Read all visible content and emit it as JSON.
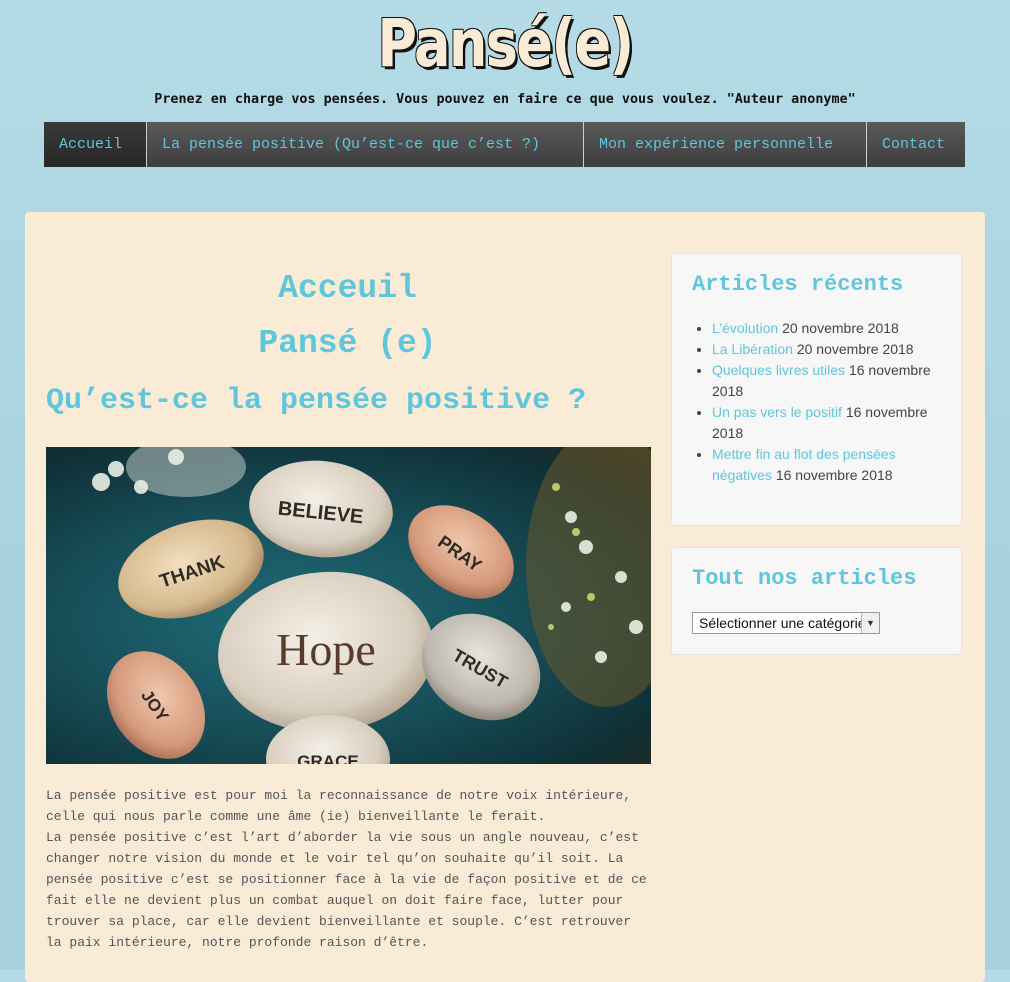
{
  "header": {
    "site_title": "Pansé(e)",
    "tagline": "Prenez en charge vos pensées. Vous pouvez en faire ce que vous voulez. \"Auteur anonyme\""
  },
  "nav": {
    "items": [
      {
        "label": "Accueil"
      },
      {
        "label": "La pensée positive (Qu’est-ce que c’est ?)"
      },
      {
        "label": "Mon expérience personnelle"
      },
      {
        "label": "Contact"
      }
    ]
  },
  "main": {
    "title1": "Acceuil",
    "title2": "Pansé (e)",
    "question": "Qu’est-ce la pensée positive ?",
    "image": {
      "stones": [
        "BELIEVE",
        "THANK",
        "PRAY",
        "Hope",
        "TRUST",
        "JOY",
        "GRACE"
      ]
    },
    "paragraph1": "La pensée positive est pour moi la reconnaissance de notre voix intérieure, celle qui nous parle comme une âme (ie) bienveillante le ferait.",
    "paragraph2": "La pensée positive c’est l’art d’aborder la vie sous un angle nouveau, c’est changer notre vision du monde et le voir tel qu’on souhaite qu’il soit. La pensée positive c’est se positionner face à la vie de façon positive et de ce fait elle ne devient plus un combat auquel on doit faire face, lutter pour trouver sa place, car elle devient bienveillante et souple. C’est retrouver la paix intérieure, notre profonde raison d’être."
  },
  "sidebar": {
    "recent": {
      "title": "Articles récents",
      "items": [
        {
          "link": "L’évolution",
          "date": "20 novembre 2018"
        },
        {
          "link": "La Libération",
          "date": "20 novembre 2018"
        },
        {
          "link": "Quelques livres utiles",
          "date": "16 novembre 2018"
        },
        {
          "link": "Un pas vers le positif",
          "date": "16 novembre 2018"
        },
        {
          "link": "Mettre fin au flot des pensées négatives",
          "date": "16 novembre 2018"
        }
      ]
    },
    "categories": {
      "title": "Tout nos articles",
      "select_value": "Sélectionner une catégorie"
    }
  },
  "colors": {
    "accent": "#5fc6dc",
    "content_bg": "#faebd7",
    "page_bg": "#a9d3e0",
    "nav_bg": "#444444"
  }
}
